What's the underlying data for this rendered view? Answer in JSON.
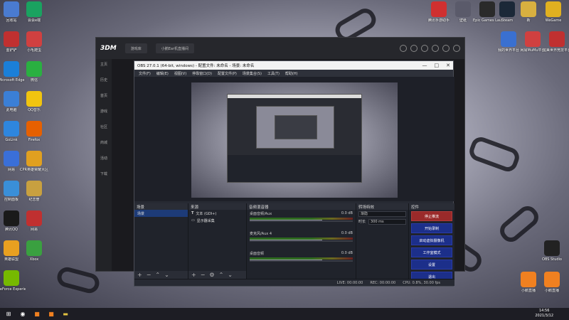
{
  "desktop": {
    "left_icons": [
      {
        "label": "回收站",
        "icon": "recycle-bin-icon",
        "color": "#4a7bd0"
      },
      {
        "label": "会会e端",
        "icon": "app-icon",
        "color": "#1aa260"
      },
      {
        "label": "金铲铲",
        "icon": "game-icon",
        "color": "#c03030"
      },
      {
        "label": "小毛爬虫",
        "icon": "app-icon",
        "color": "#d04040"
      },
      {
        "label": "Microsoft Edge",
        "icon": "edge-icon",
        "color": "#1b7fd8"
      },
      {
        "label": "微信",
        "icon": "wechat-icon",
        "color": "#2ab041"
      },
      {
        "label": "此电脑",
        "icon": "computer-icon",
        "color": "#3b7fd6"
      },
      {
        "label": "QQ音乐",
        "icon": "qqmusic-icon",
        "color": "#f1c40f"
      },
      {
        "label": "GoLink",
        "icon": "golink-icon",
        "color": "#2e86de"
      },
      {
        "label": "Firefox",
        "icon": "firefox-icon",
        "color": "#e66000"
      },
      {
        "label": "网易",
        "icon": "app-icon",
        "color": "#3a6fd8"
      },
      {
        "label": "CPR英雄荣耀大区",
        "icon": "game-icon",
        "color": "#e0a020"
      },
      {
        "label": "控制面板",
        "icon": "control-panel-icon",
        "color": "#3a8fd8"
      },
      {
        "label": "纪念册",
        "icon": "app-icon",
        "color": "#c8a040"
      },
      {
        "label": "腾讯QQ",
        "icon": "qq-icon",
        "color": "#1a1a1a"
      },
      {
        "label": "网易",
        "icon": "app-icon",
        "color": "#c03030"
      },
      {
        "label": "英雄联盟",
        "icon": "game-icon",
        "color": "#e8a020"
      },
      {
        "label": "Xbox",
        "icon": "app-icon",
        "color": "#3aa040"
      },
      {
        "label": "GeForce Experience",
        "icon": "nvidia-icon",
        "color": "#76b900"
      }
    ],
    "right_icons": [
      {
        "label": "腾讯手游助手",
        "icon": "game-icon",
        "color": "#d03030"
      },
      {
        "label": "壁纸",
        "icon": "app-icon",
        "color": "#5a5a6a"
      },
      {
        "label": "Epic Games Launcher",
        "icon": "epic-icon",
        "color": "#2a2a2a"
      },
      {
        "label": "Steam",
        "icon": "steam-icon",
        "color": "#1b2838"
      },
      {
        "label": "新",
        "icon": "folder-icon",
        "color": "#d8b040"
      },
      {
        "label": "WeGame",
        "icon": "wegame-icon",
        "color": "#e0b020"
      },
      {
        "label": "我的世界平台",
        "icon": "app-icon",
        "color": "#3a70d0"
      },
      {
        "label": "网易MuMu平台",
        "icon": "app-icon",
        "color": "#d04040"
      },
      {
        "label": "完美世界竞技平台",
        "icon": "app-icon",
        "color": "#c03030"
      },
      {
        "label": "OBS Studio",
        "icon": "obs-icon",
        "color": "#222"
      },
      {
        "label": "小鹅直播",
        "icon": "app-icon",
        "color": "#f08020"
      },
      {
        "label": "小鹅直播",
        "icon": "app-icon",
        "color": "#f08020"
      }
    ]
  },
  "taskbar": {
    "time": "14:56",
    "date": "2021/3/12"
  },
  "browser": {
    "logo": "3DM",
    "tabs": [
      "游戏库",
      "小鹅Ear机直播间"
    ],
    "side_items": [
      "主页",
      "历史",
      "首页",
      "游戏",
      "社区",
      "商城",
      "活动",
      "下载"
    ]
  },
  "obs": {
    "title": "OBS 27.0.1 (64-bit, windows) - 配置文件: 未命名 - 场景: 未命名",
    "menu": [
      "文件(F)",
      "编辑(E)",
      "视图(V)",
      "停靠窗口(D)",
      "配置文件(P)",
      "场景集合(S)",
      "工具(T)",
      "帮助(H)"
    ],
    "docks": {
      "scenes": {
        "title": "场景",
        "items": [
          "场景"
        ]
      },
      "sources": {
        "title": "来源",
        "items": [
          "文本 (GDI+)",
          "显示器采集"
        ]
      },
      "mixer": {
        "title": "音频混音器",
        "channels": [
          {
            "name": "桌面音频/Aux",
            "level": "0.0 dB"
          },
          {
            "name": "麦克风/Aux 4",
            "level": "0.0 dB"
          },
          {
            "name": "桌面音频",
            "level": "0.0 dB"
          }
        ]
      },
      "transitions": {
        "title": "转场特效",
        "type": "渐隐",
        "duration_label": "时长",
        "duration": "300 ms"
      },
      "controls": {
        "title": "控件",
        "buttons": [
          "停止推流",
          "开始录制",
          "启动虚拟摄像机",
          "工作室模式",
          "设置",
          "退出"
        ]
      }
    },
    "status": {
      "live": "LIVE: 00:00:00",
      "rec": "REC: 00:00:00",
      "cpu": "CPU: 0.8%, 30.00 fps"
    }
  }
}
